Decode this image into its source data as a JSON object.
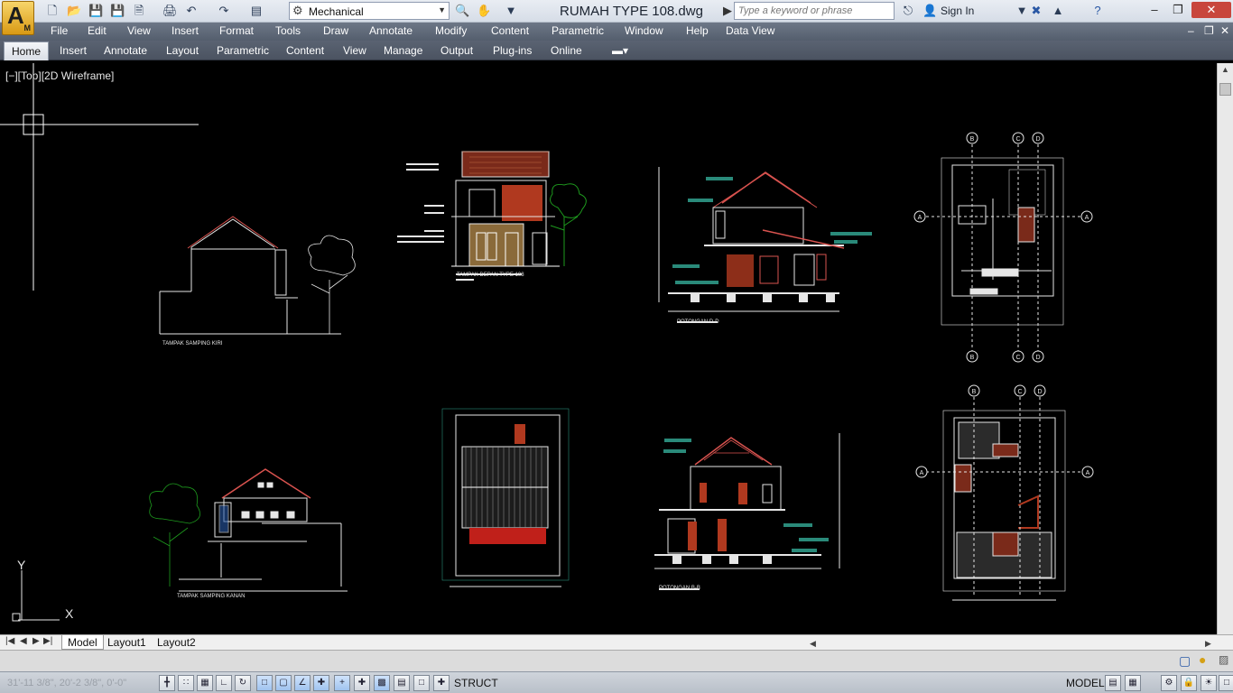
{
  "titlebar": {
    "app_letter": "A",
    "app_sub": "M",
    "workspace": "Mechanical",
    "document_title": "RUMAH TYPE 108.dwg",
    "search_placeholder": "Type a keyword or phrase",
    "sign_in": "Sign In",
    "help": "?"
  },
  "menu": [
    "File",
    "Edit",
    "View",
    "Insert",
    "Format",
    "Tools",
    "Draw",
    "Annotate",
    "Modify",
    "Content",
    "Parametric",
    "Window",
    "Help",
    "Data View"
  ],
  "ribbon_tabs": [
    "Home",
    "Insert",
    "Annotate",
    "Layout",
    "Parametric",
    "Content",
    "View",
    "Manage",
    "Output",
    "Plug-ins",
    "Online"
  ],
  "viewport_label": "[−][Top][2D Wireframe]",
  "ucs": {
    "x": "X",
    "y": "Y"
  },
  "drawing_titles": {
    "left_side": "TAMPAK SAMPING KIRI",
    "front": "TAMPAK DEPAN TYPE 108",
    "section_dd": "POTONGAN D-D",
    "right_side": "TAMPAK SAMPING KANAN",
    "section_bb": "POTONGAN B-B"
  },
  "grid_bubbles": {
    "A": "A",
    "B": "B",
    "C": "C",
    "D": "D"
  },
  "layout_tabs": [
    "Model",
    "Layout1",
    "Layout2"
  ],
  "status": {
    "coords": "31'-11 3/8\", 20'-2 3/8\", 0'-0\"",
    "struct": "STRUCT",
    "model": "MODEL"
  },
  "colors": {
    "canvas": "#000000",
    "accent_red": "#b03a1e",
    "tree_green": "#1e9b1e",
    "dim_teal": "#2a8a7a"
  }
}
